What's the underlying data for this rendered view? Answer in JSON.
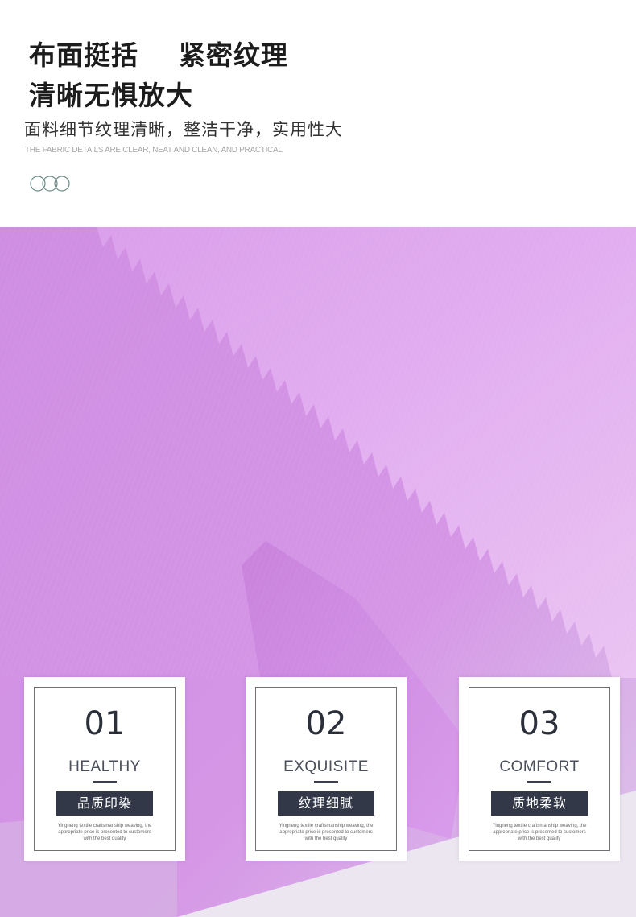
{
  "header": {
    "title_line1": "布面挺括    紧密纹理",
    "title_line2": "清晰无惧放大",
    "subtitle": "面料细节纹理清晰，整洁干净，实用性大",
    "subtitle_en": "THE FABRIC DETAILS ARE CLEAR, NEAT AND CLEAN, AND PRACTICAL"
  },
  "colors": {
    "fabric": "#d494e6",
    "fabric_light": "#e6b2f0",
    "label_bg": "#323848",
    "title": "#1c1c1c"
  },
  "features": [
    {
      "number": "01",
      "english": "HEALTHY",
      "label": "品质印染",
      "desc": "Yingneng textile craftsmanship weaving, the appropriate price is presented to customers with the best quality"
    },
    {
      "number": "02",
      "english": "EXQUISITE",
      "label": "纹理细腻",
      "desc": "Yingneng textile craftsmanship weaving, the appropriate price is presented to customers with the best quality"
    },
    {
      "number": "03",
      "english": "COMFORT",
      "label": "质地柔软",
      "desc": "Yingneng textile craftsmanship weaving, the appropriate price is presented to customers with the best quality"
    }
  ]
}
